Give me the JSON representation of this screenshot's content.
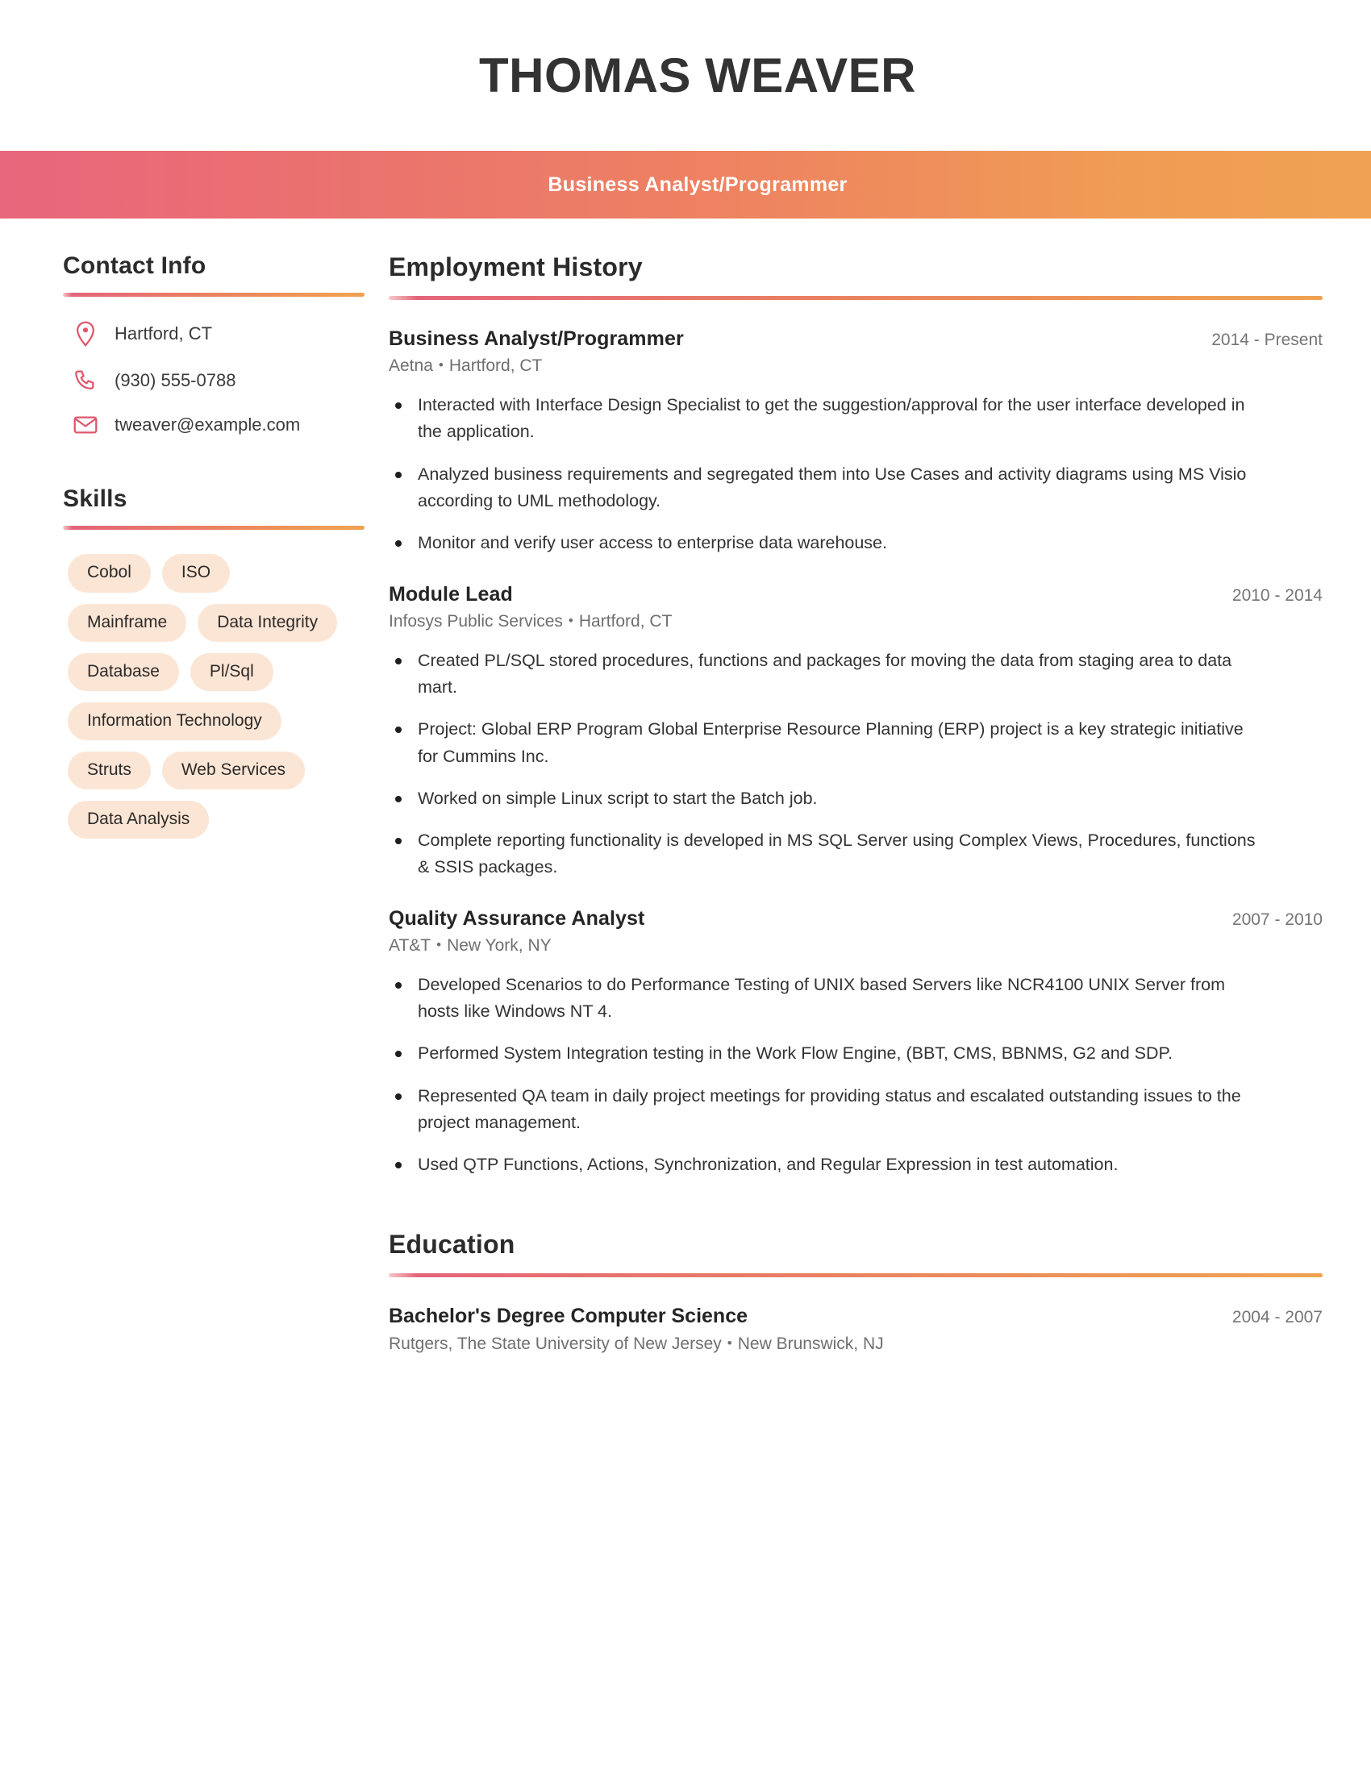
{
  "header": {
    "name": "THOMAS WEAVER",
    "title": "Business Analyst/Programmer",
    "band_gradient_start": "#e8677c",
    "band_gradient_end": "#f0a252"
  },
  "sidebar": {
    "contact": {
      "heading": "Contact Info",
      "items": [
        {
          "icon": "location-pin-icon",
          "value": "Hartford, CT"
        },
        {
          "icon": "phone-icon",
          "value": "(930) 555-0788"
        },
        {
          "icon": "envelope-icon",
          "value": "tweaver@example.com"
        }
      ]
    },
    "skills": {
      "heading": "Skills",
      "items": [
        "Cobol",
        "ISO",
        "Mainframe",
        "Data Integrity",
        "Database",
        "Pl/Sql",
        "Information Technology",
        "Struts",
        "Web Services",
        "Data Analysis"
      ],
      "pill_background": "#fbe6d6"
    }
  },
  "main": {
    "employment": {
      "heading": "Employment History",
      "jobs": [
        {
          "position": "Business Analyst/Programmer",
          "dates": "2014 - Present",
          "company": "Aetna",
          "location": "Hartford, CT",
          "bullets": [
            "Interacted with Interface Design Specialist to get the suggestion/approval for the user interface developed in the application.",
            "Analyzed business requirements and segregated them into Use Cases and activity diagrams using MS Visio according to UML methodology.",
            "Monitor and verify user access to enterprise data warehouse."
          ]
        },
        {
          "position": "Module Lead",
          "dates": "2010 - 2014",
          "company": "Infosys Public Services",
          "location": "Hartford, CT",
          "bullets": [
            "Created PL/SQL stored procedures, functions and packages for moving the data from staging area to data mart.",
            "Project: Global ERP Program Global Enterprise Resource Planning (ERP) project is a key strategic initiative for Cummins Inc.",
            "Worked on simple Linux script to start the Batch job.",
            "Complete reporting functionality is developed in MS SQL Server using Complex Views, Procedures, functions & SSIS packages."
          ]
        },
        {
          "position": "Quality Assurance Analyst",
          "dates": "2007 - 2010",
          "company": "AT&T",
          "location": "New York, NY",
          "bullets": [
            "Developed Scenarios to do Performance Testing of UNIX based Servers like NCR4100 UNIX Server from hosts like Windows NT 4.",
            "Performed System Integration testing in the Work Flow Engine, (BBT, CMS, BBNMS, G2 and SDP.",
            "Represented QA team in daily project meetings for providing status and escalated outstanding issues to the project management.",
            "Used QTP Functions, Actions, Synchronization, and Regular Expression in test automation."
          ]
        }
      ]
    },
    "education": {
      "heading": "Education",
      "entries": [
        {
          "degree": "Bachelor's Degree Computer Science",
          "dates": "2004 - 2007",
          "school": "Rutgers, The State University of New Jersey",
          "location": "New Brunswick, NJ"
        }
      ]
    }
  },
  "separator": "•"
}
